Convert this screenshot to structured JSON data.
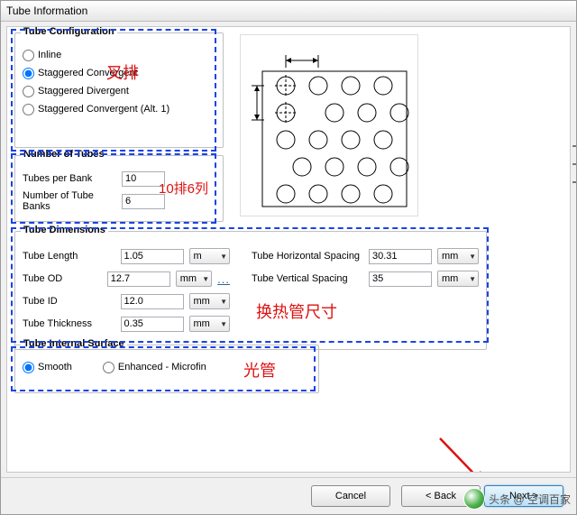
{
  "window": {
    "title": "Tube Information"
  },
  "tubeConfig": {
    "legend": "Tube Configuration",
    "options": {
      "inline": "Inline",
      "staggeredConv": "Staggered Convergent",
      "staggeredDiv": "Staggered Divergent",
      "staggeredAlt": "Staggered Convergent (Alt. 1)"
    }
  },
  "numTubes": {
    "legend": "Number of Tubes",
    "rows": {
      "perBankLabel": "Tubes per Bank",
      "perBankValue": "10",
      "banksLabel": "Number of Tube Banks",
      "banksValue": "6"
    }
  },
  "tubeDims": {
    "legend": "Tube Dimensions",
    "left": {
      "lengthLabel": "Tube Length",
      "lengthValue": "1.05",
      "lengthUnit": "m",
      "odLabel": "Tube OD",
      "odValue": "12.7",
      "odUnit": "mm",
      "idLabel": "Tube ID",
      "idValue": "12.0",
      "idUnit": "mm",
      "thickLabel": "Tube Thickness",
      "thickValue": "0.35",
      "thickUnit": "mm"
    },
    "right": {
      "hspLabel": "Tube Horizontal Spacing",
      "hspValue": "30.31",
      "hspUnit": "mm",
      "vspLabel": "Tube Vertical Spacing",
      "vspValue": "35",
      "vspUnit": "mm"
    },
    "ellipsis": "..."
  },
  "internalSurf": {
    "legend": "Tube Internal Surface",
    "smooth": "Smooth",
    "enhanced": "Enhanced - Microfin"
  },
  "annotations": {
    "chapai": "叉排",
    "pailie": "10排6列",
    "huanre": "换热管尺寸",
    "guang": "光管"
  },
  "buttons": {
    "cancel": "Cancel",
    "back": "< Back",
    "next": "Next >"
  },
  "watermark": {
    "text": "头条 @ 空调百家"
  }
}
